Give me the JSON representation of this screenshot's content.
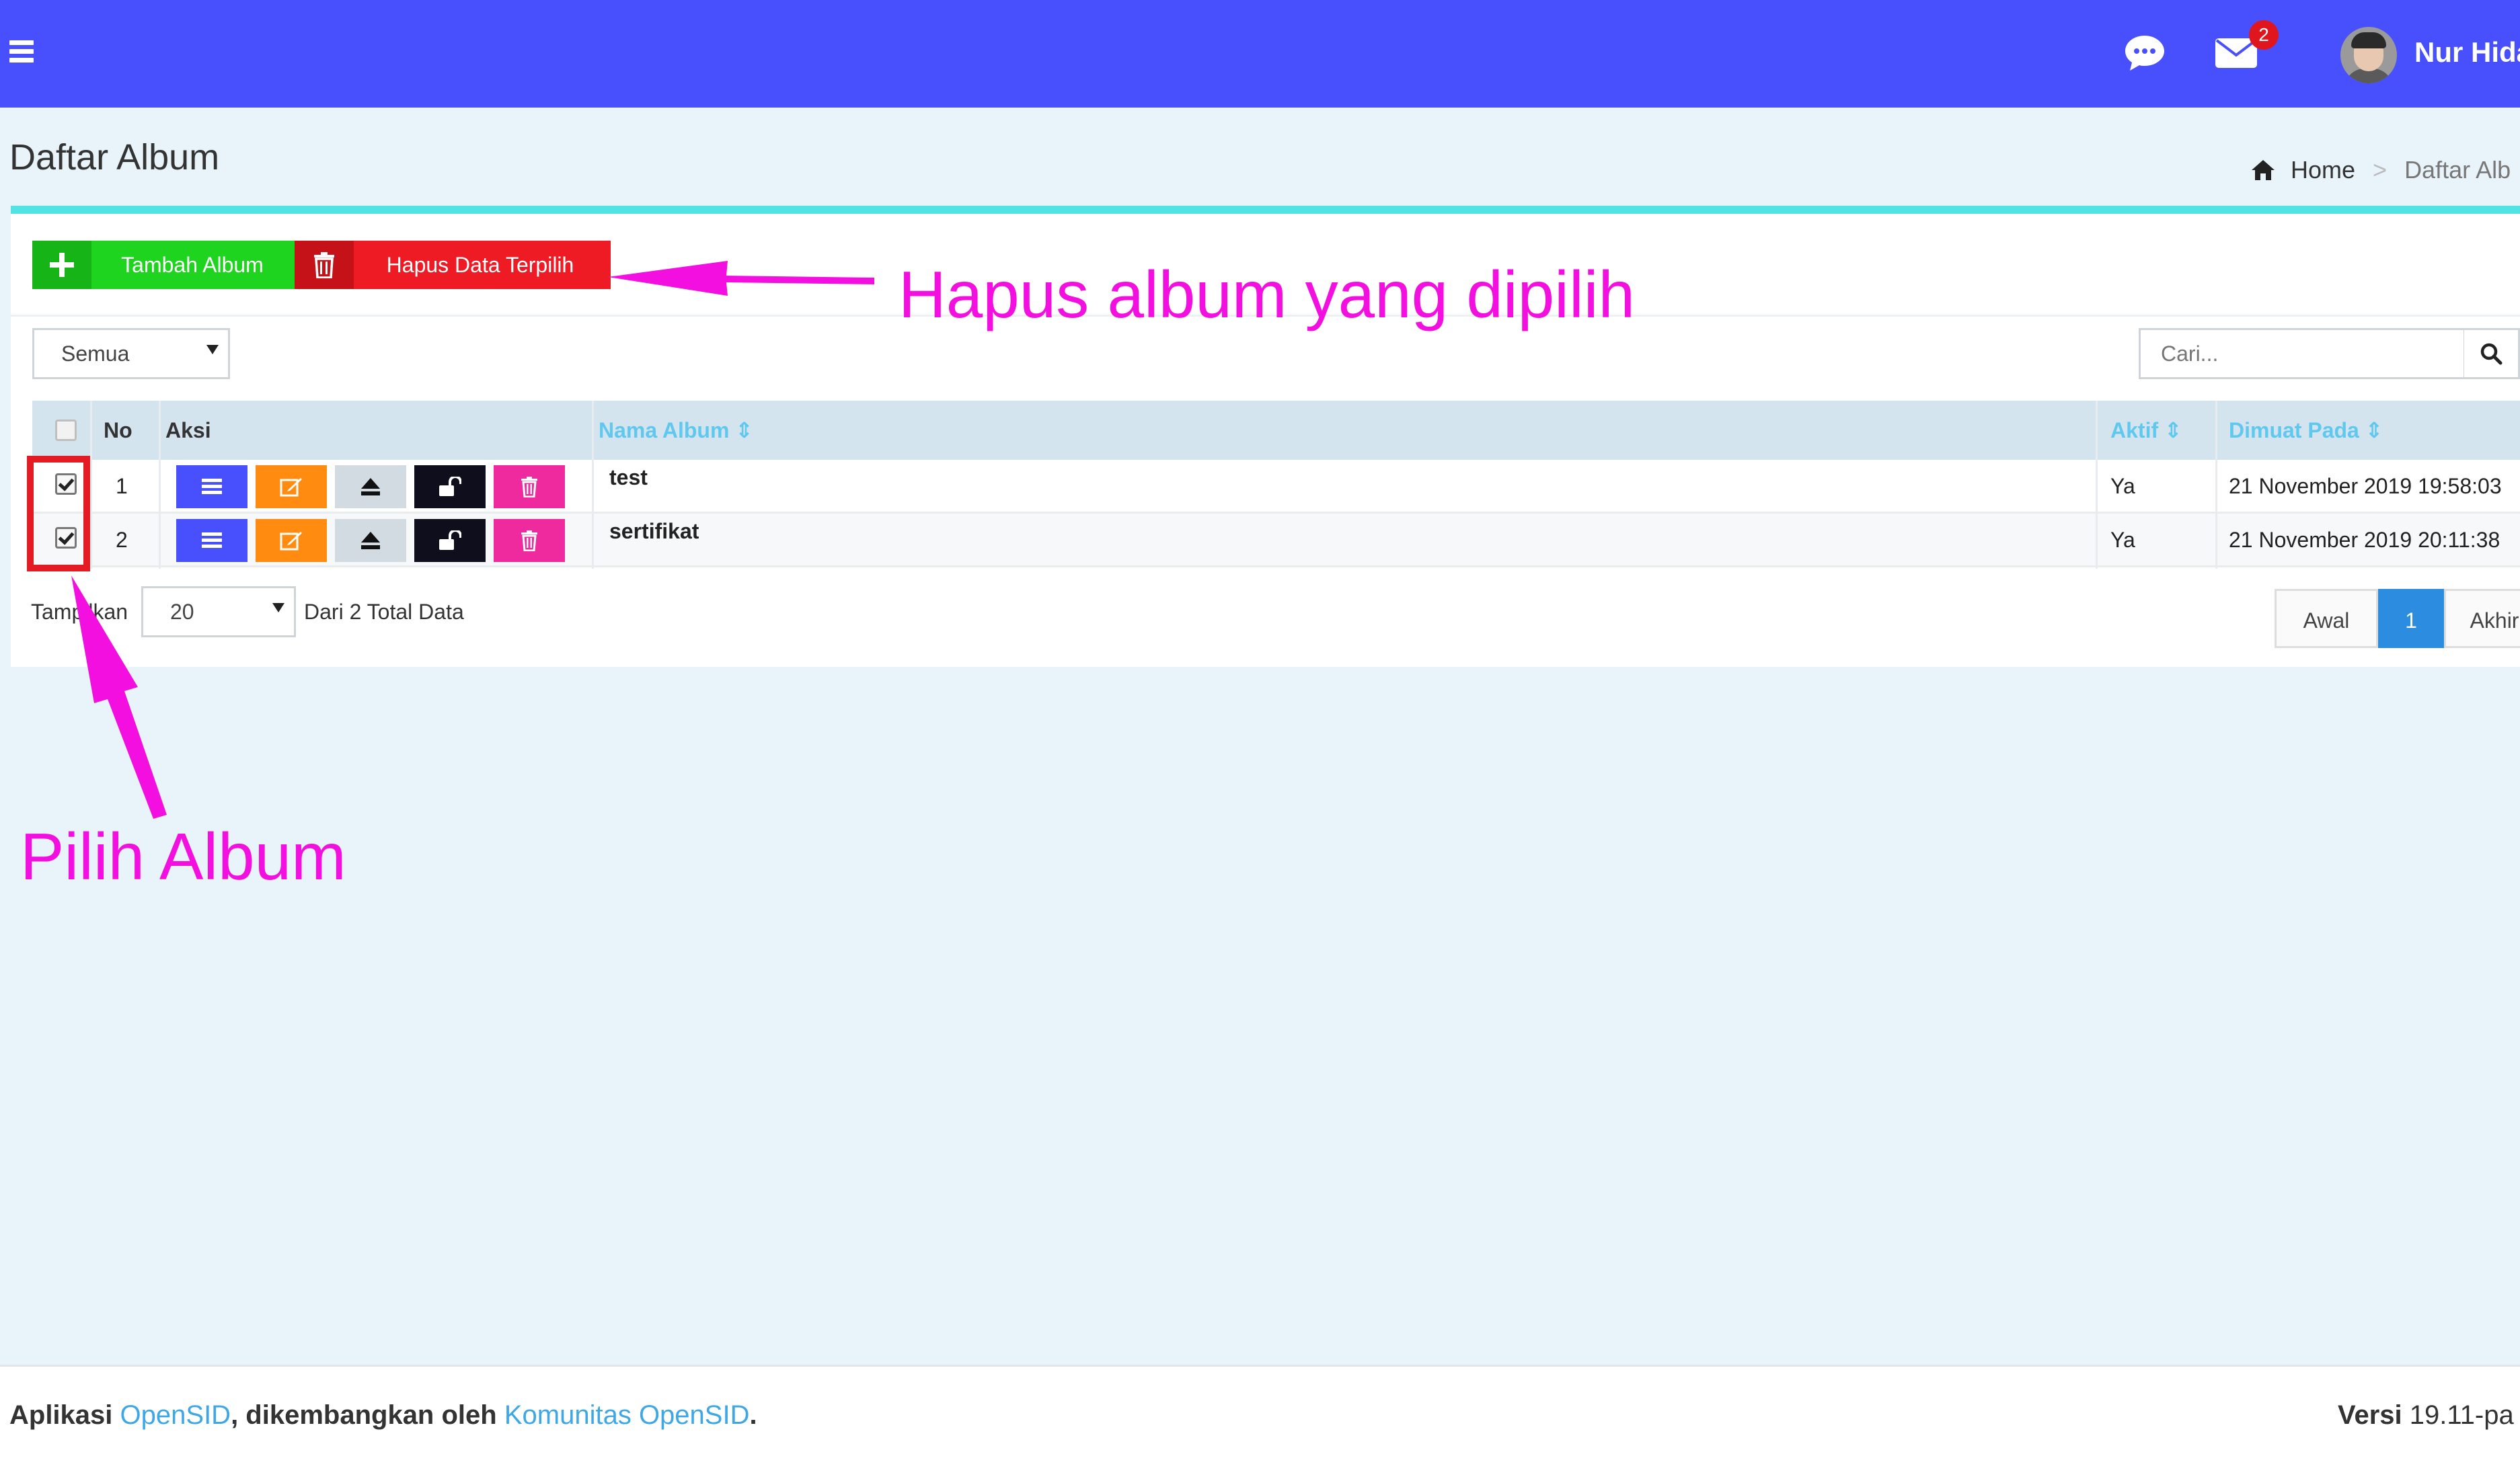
{
  "header": {
    "username": "Nur Hida",
    "mail_badge": "2"
  },
  "page": {
    "title": "Daftar Album",
    "breadcrumb_home": "Home",
    "breadcrumb_sep": ">",
    "breadcrumb_current": "Daftar Alb"
  },
  "toolbar": {
    "add_label": "Tambah Album",
    "delete_label": "Hapus Data Terpilih"
  },
  "filter": {
    "status_value": "Semua",
    "search_placeholder": "Cari..."
  },
  "table": {
    "columns": [
      "No",
      "Aksi",
      "Nama Album",
      "Aktif",
      "Dimuat Pada"
    ],
    "sort_glyph": "⇕",
    "rows": [
      {
        "checked": true,
        "no": "1",
        "name": "test",
        "active": "Ya",
        "date": "21 November 2019 19:58:03"
      },
      {
        "checked": true,
        "no": "2",
        "name": "sertifikat",
        "active": "Ya",
        "date": "21 November 2019 20:11:38"
      }
    ]
  },
  "pagination": {
    "show_label": "Tampilkan",
    "per_page": "20",
    "total_prefix": "Dari",
    "total": "2",
    "total_suffix": "Total Data",
    "first": "Awal",
    "current": "1",
    "last": "Akhir"
  },
  "annotations": {
    "delete_note": "Hapus album yang dipilih",
    "select_note": "Pilih Album",
    "color": "#f20fe0"
  },
  "footer": {
    "prefix": "Aplikasi",
    "app_name": "OpenSID",
    "middle": ", dikembangkan oleh",
    "community": "Komunitas OpenSID",
    "suffix": ".",
    "version_label": "Versi",
    "version": "19.11-pa"
  },
  "colors": {
    "topbar": "#4850fd",
    "add": "#1fd41f",
    "delete": "#ee1b25",
    "accent": "#50e3e3",
    "link": "#3ea8e6"
  }
}
